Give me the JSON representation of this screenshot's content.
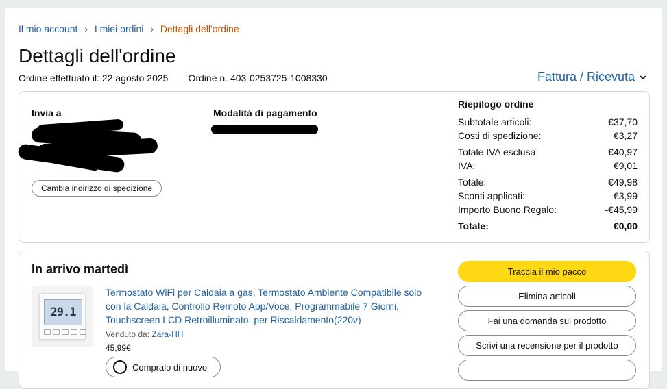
{
  "breadcrumb": {
    "account": "Il mio account",
    "orders": "I miei ordini",
    "current": "Dettagli dell'ordine",
    "separator": "›"
  },
  "page_title": "Dettagli dell'ordine",
  "order_meta": {
    "placed": "Ordine effettuato il: 22 agosto 2025",
    "number": "Ordine n. 403-0253725-1008330"
  },
  "invoice_link": "Fattura / Ricevuta",
  "shipping": {
    "title": "Invia a",
    "change_address_button": "Cambia indirizzo di spedizione"
  },
  "payment": {
    "title": "Modalità di pagamento"
  },
  "summary": {
    "title": "Riepilogo ordine",
    "rows": [
      {
        "label": "Subtotale articoli:",
        "value": "€37,70"
      },
      {
        "label": "Costi di spedizione:",
        "value": "€3,27"
      },
      {
        "label": "Totale IVA esclusa:",
        "value": "€40,97"
      },
      {
        "label": "IVA:",
        "value": "€9,01"
      },
      {
        "label": "Totale:",
        "value": "€49,98"
      },
      {
        "label": "Sconti applicati:",
        "value": "-€3,99"
      },
      {
        "label": "Importo Buono Regalo:",
        "value": "-€45,99"
      },
      {
        "label": "Totale:",
        "value": "€0,00"
      }
    ]
  },
  "shipment": {
    "arrival": "In arrivo martedì",
    "product_title": "Termostato WiFi per Caldaia a gas, Termostato Ambiente Compatibile solo con la Caldaia, Controllo Remoto App/Voce, Programmabile 7 Giorni, Touchscreen LCD Retroilluminato, per Riscaldamento(220v)",
    "sold_by_label": "Venduto da:",
    "seller": "Zara-HH",
    "price": "45,99€",
    "buy_again": "Compralo di nuovo",
    "thumbnail_display": "29.1",
    "actions": {
      "track": "Traccia il mio pacco",
      "delete": "Elimina articoli",
      "question": "Fai una domanda sul prodotto",
      "review": "Scrivi una recensione per il prodotto"
    }
  },
  "colors": {
    "link": "#2162a1",
    "breadcrumb_current": "#c45500",
    "primary_button": "#ffd814"
  }
}
